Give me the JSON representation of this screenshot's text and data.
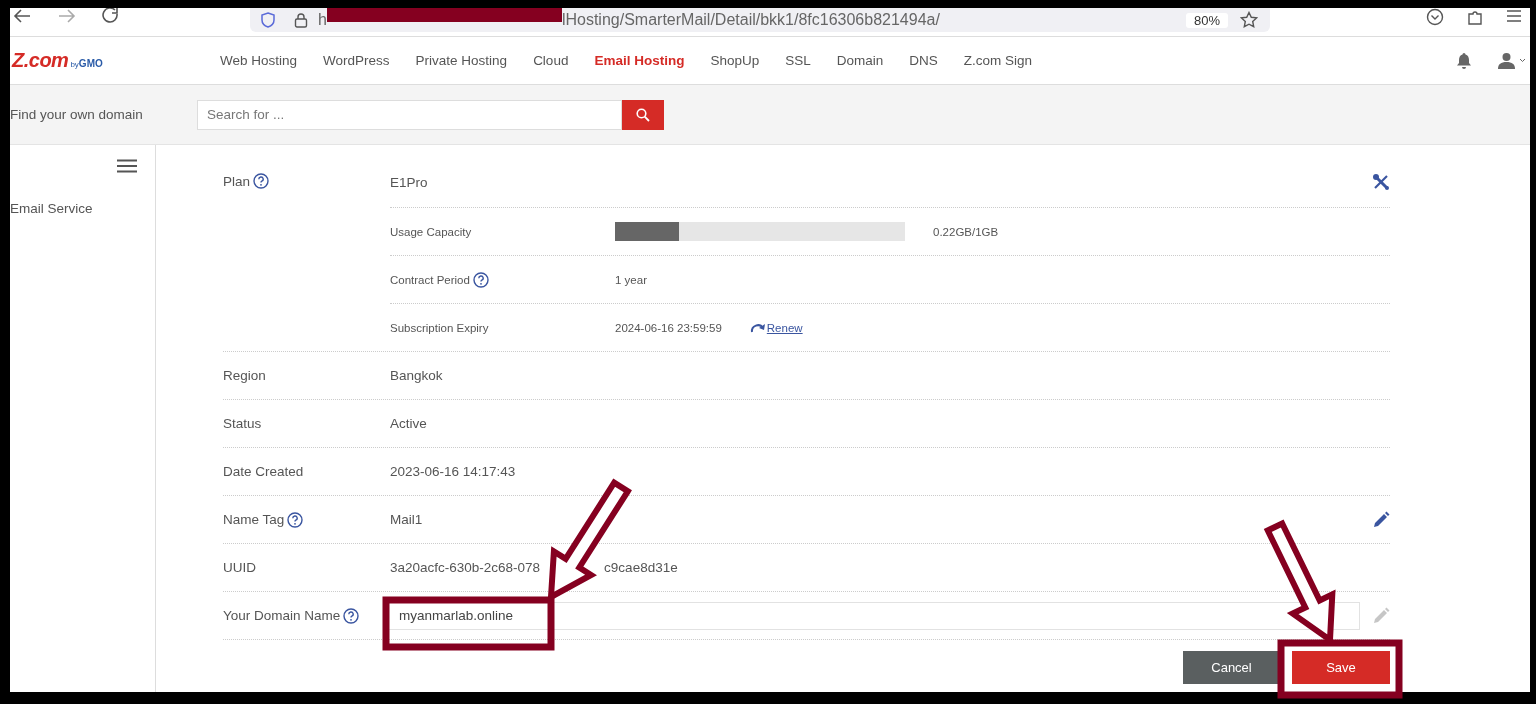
{
  "browser": {
    "url_start": "h",
    "url_end": "lHosting/SmarterMail/Detail/bkk1/8fc16306b821494a/",
    "zoom": "80%"
  },
  "header": {
    "logo": {
      "main": "Z.com",
      "by": "by",
      "brand": "GMO"
    },
    "nav": [
      {
        "label": "Web Hosting",
        "selected": false
      },
      {
        "label": "WordPress",
        "selected": false
      },
      {
        "label": "Private Hosting",
        "selected": false
      },
      {
        "label": "Cloud",
        "selected": false
      },
      {
        "label": "Email Hosting",
        "selected": true
      },
      {
        "label": "ShopUp",
        "selected": false
      },
      {
        "label": "SSL",
        "selected": false
      },
      {
        "label": "Domain",
        "selected": false
      },
      {
        "label": "DNS",
        "selected": false
      },
      {
        "label": "Z.com Sign",
        "selected": false
      }
    ]
  },
  "search": {
    "label": "Find your own domain",
    "placeholder": "Search for ..."
  },
  "sidebar": {
    "items": [
      {
        "label": "Email Service"
      }
    ]
  },
  "plan": {
    "label": "Plan",
    "help": true,
    "value": "E1Pro",
    "details": [
      {
        "kind": "meter",
        "label": "Usage Capacity",
        "level": 0.22,
        "reading": "0.22GB/1GB"
      },
      {
        "kind": "text",
        "label": "Contract Period",
        "help": true,
        "value": "1 year"
      },
      {
        "kind": "renew",
        "label": "Subscription Expiry",
        "value": "2024-06-16 23:59:59",
        "link": "Renew"
      }
    ]
  },
  "rows": [
    {
      "kind": "text",
      "label": "Region",
      "value": "Bangkok"
    },
    {
      "kind": "text",
      "label": "Status",
      "value": "Active"
    },
    {
      "kind": "text",
      "label": "Date Created",
      "value": "2023-06-16 14:17:43"
    },
    {
      "kind": "text",
      "label": "Name Tag",
      "help": true,
      "value": "Mail1",
      "edit": {
        "disabled": false
      }
    },
    {
      "kind": "split",
      "label": "UUID",
      "value": "3a20acfc-630b-2c68-078",
      "value_tail": "c9cae8d31e"
    },
    {
      "kind": "input",
      "label": "Your Domain Name",
      "help": true,
      "value": "myanmarlab.online",
      "edit": {
        "disabled": true
      }
    }
  ],
  "buttons": [
    {
      "label": "Cancel",
      "kind": "secondary"
    },
    {
      "label": "Save",
      "kind": "primary"
    }
  ]
}
